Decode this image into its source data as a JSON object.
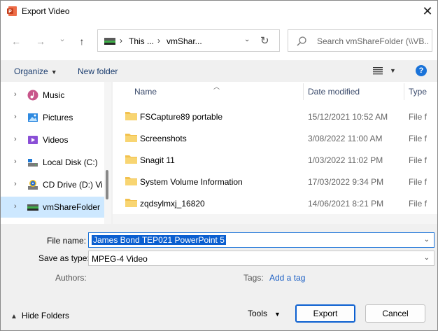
{
  "window": {
    "title": "Export Video",
    "close_symbol": "✕"
  },
  "nav": {
    "back_symbol": "←",
    "forward_symbol": "→",
    "recent_symbol": "⌄",
    "up_symbol": "↑",
    "address": {
      "sep1": "›",
      "segment1": "This ...",
      "sep2": "›",
      "segment2": "vmShar...",
      "dropdown_symbol": "⌄",
      "refresh_symbol": "↻"
    },
    "search": {
      "placeholder": "Search vmShareFolder (\\\\VB..."
    }
  },
  "toolbar": {
    "organize_label": "Organize",
    "new_folder_label": "New folder",
    "help_symbol": "?"
  },
  "tree": {
    "items": [
      {
        "label": "Music",
        "icon": "music-icon"
      },
      {
        "label": "Pictures",
        "icon": "pictures-icon"
      },
      {
        "label": "Videos",
        "icon": "videos-icon"
      },
      {
        "label": "Local Disk (C:)",
        "icon": "drive-icon"
      },
      {
        "label": "CD Drive (D:) Vi",
        "icon": "cd-drive-icon"
      },
      {
        "label": "vmShareFolder",
        "icon": "network-drive-icon",
        "selected": true
      }
    ]
  },
  "columns": {
    "name": "Name",
    "date_modified": "Date modified",
    "type": "Type"
  },
  "files": [
    {
      "name": "FSCapture89 portable",
      "date": "15/12/2021 10:52 AM",
      "type": "File f"
    },
    {
      "name": "Screenshots",
      "date": "3/08/2022 11:00 AM",
      "type": "File f"
    },
    {
      "name": "Snagit 11",
      "date": "1/03/2022 11:02 PM",
      "type": "File f"
    },
    {
      "name": "System Volume Information",
      "date": "17/03/2022 9:34 PM",
      "type": "File f"
    },
    {
      "name": "zqdsylmxj_16820",
      "date": "14/06/2021 8:21 PM",
      "type": "File f"
    }
  ],
  "form": {
    "file_name_label": "File name:",
    "file_name_value": "James Bond TEP021 PowerPoint 5",
    "save_as_type_label": "Save as type:",
    "save_as_type_value": "MPEG-4 Video",
    "authors_label": "Authors:",
    "tags_label": "Tags:",
    "add_tag_label": "Add a tag"
  },
  "footer": {
    "hide_folders_label": "Hide Folders",
    "tools_label": "Tools",
    "export_label": "Export",
    "cancel_label": "Cancel"
  },
  "colors": {
    "accent": "#0b5fd0",
    "selection_bg": "#cde8ff",
    "folder": "#f2c14e",
    "link": "#1a5ec4"
  }
}
